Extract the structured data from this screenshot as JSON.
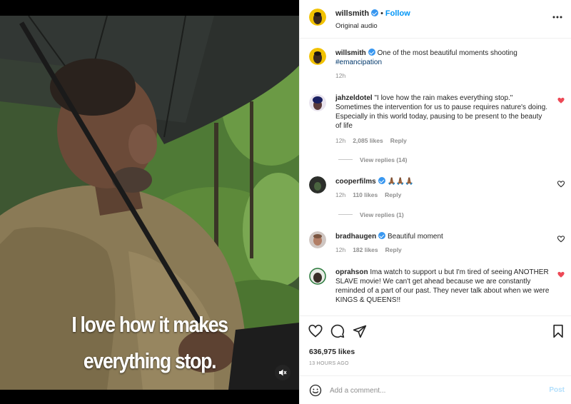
{
  "media": {
    "caption_line1": "I love how it makes",
    "caption_line2": "everything stop.",
    "mute_icon": "speaker-muted-icon"
  },
  "header": {
    "username": "willsmith",
    "separator": "•",
    "follow_label": "Follow",
    "subtitle": "Original audio",
    "more_icon": "more-options-icon"
  },
  "caption": {
    "username": "willsmith",
    "text": "One of the most beautiful moments shooting",
    "hashtag": "#emancipation",
    "time": "12h"
  },
  "comments": [
    {
      "username": "jahzeldotel",
      "text": "\"I love how the rain makes everything stop.\" Sometimes the intervention for us to pause requires nature's doing. Especially in this world today, pausing to be present to the beauty of life",
      "time": "12h",
      "likes": "2,085 likes",
      "reply": "Reply",
      "view_replies": "View replies (14)",
      "liked": true
    },
    {
      "username": "cooperfilms",
      "text": "🙏🏾🙏🏾🙏🏾",
      "time": "12h",
      "likes": "110 likes",
      "reply": "Reply",
      "view_replies": "View replies (1)",
      "liked": false
    },
    {
      "username": "bradhaugen",
      "text": "Beautiful moment",
      "time": "12h",
      "likes": "182 likes",
      "reply": "Reply",
      "liked": false
    },
    {
      "username": "oprahson",
      "text": "Ima watch to support u but I'm tired of seeing ANOTHER SLAVE movie! We can't get ahead because we are constantly reminded of a part of our past. They never talk about when we were KINGS & QUEENS!!",
      "liked": true
    }
  ],
  "actions": {
    "likes": "636,975 likes",
    "time": "13 HOURS AGO"
  },
  "add_comment": {
    "placeholder": "Add a comment...",
    "post_label": "Post"
  },
  "colors": {
    "accent": "#0095f6",
    "verified": "#3897f0",
    "like_red": "#ed4956",
    "muted_text": "#8e8e8e"
  }
}
